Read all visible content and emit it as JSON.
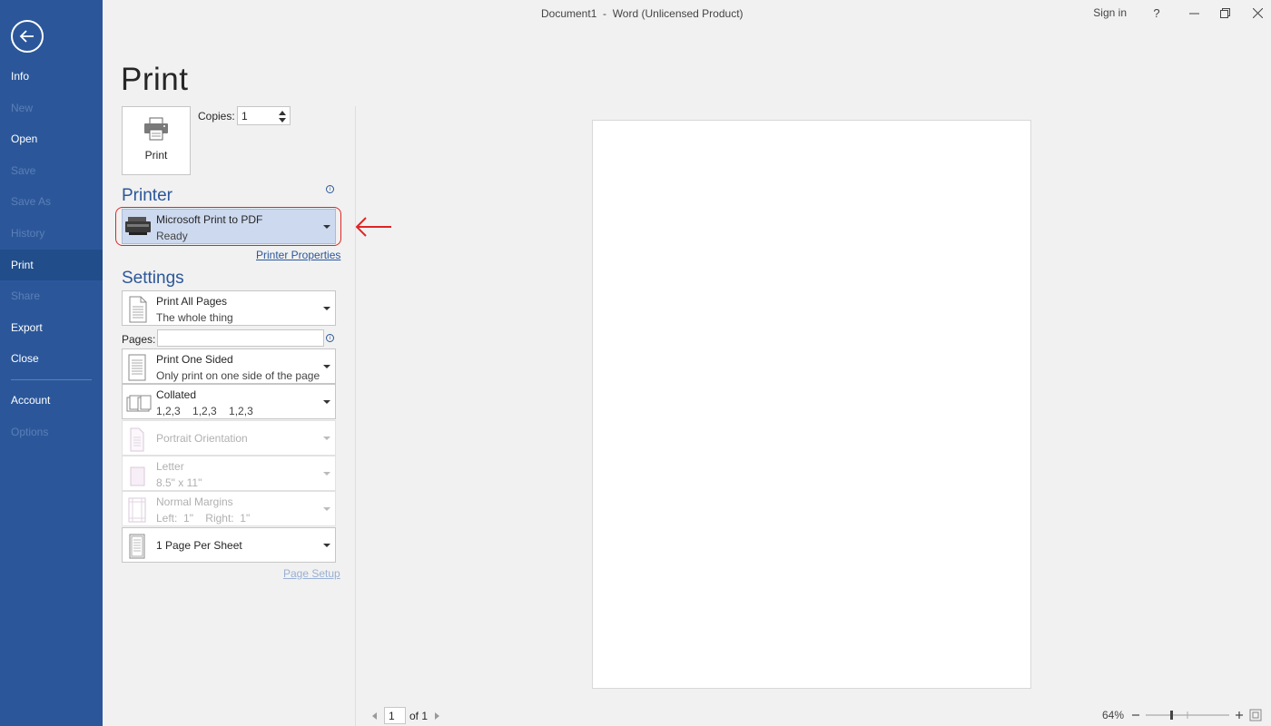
{
  "window": {
    "title": "Document1  -  Word (Unlicensed Product)",
    "sign_in": "Sign in",
    "help": "?"
  },
  "sidebar": {
    "items": [
      {
        "label": "Info",
        "enabled": true
      },
      {
        "label": "New",
        "enabled": false
      },
      {
        "label": "Open",
        "enabled": true
      },
      {
        "label": "Save",
        "enabled": false
      },
      {
        "label": "Save As",
        "enabled": false
      },
      {
        "label": "History",
        "enabled": false
      },
      {
        "label": "Print",
        "enabled": true,
        "active": true
      },
      {
        "label": "Share",
        "enabled": false
      },
      {
        "label": "Export",
        "enabled": true
      },
      {
        "label": "Close",
        "enabled": true
      }
    ],
    "account": "Account",
    "options": "Options"
  },
  "print": {
    "heading": "Print",
    "button_label": "Print",
    "copies_label": "Copies:",
    "copies_value": "1",
    "printer_heading": "Printer",
    "printer_name": "Microsoft Print to PDF",
    "printer_status": "Ready",
    "printer_properties": "Printer Properties",
    "settings_heading": "Settings",
    "pages_label": "Pages:",
    "page_setup": "Page Setup",
    "settings": [
      {
        "title": "Print All Pages",
        "subtitle": "The whole thing"
      },
      {
        "title": "Print One Sided",
        "subtitle": "Only print on one side of the page"
      },
      {
        "title": "Collated",
        "subtitle": "1,2,3    1,2,3    1,2,3"
      },
      {
        "title": "Portrait Orientation",
        "subtitle": ""
      },
      {
        "title": "Letter",
        "subtitle": "8.5\" x 11\""
      },
      {
        "title": "Normal Margins",
        "subtitle": "Left:  1\"    Right:  1\""
      },
      {
        "title": "1 Page Per Sheet",
        "subtitle": ""
      }
    ]
  },
  "preview": {
    "current_page": "1",
    "of_pages": "of 1",
    "zoom": "64%"
  },
  "colors": {
    "accent": "#2b579a",
    "highlight_annotation": "#e02424"
  }
}
